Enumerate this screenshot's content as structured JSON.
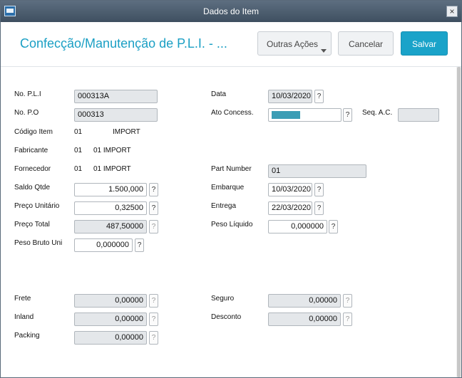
{
  "window": {
    "title": "Dados do Item",
    "close_label": "×"
  },
  "header": {
    "page_title": "Confecção/Manutenção de P.L.I. - ...",
    "more_actions_label": "Outras Ações",
    "cancel_label": "Cancelar",
    "save_label": "Salvar"
  },
  "help_label": "?",
  "form": {
    "no_pli": {
      "label": "No. P.L.I",
      "value": "000313A"
    },
    "no_po": {
      "label": "No. P.O",
      "value": "000313"
    },
    "codigo_item": {
      "label": "Código Item",
      "code": "01",
      "desc": "IMPORT"
    },
    "fabricante": {
      "label": "Fabricante",
      "code": "01",
      "desc": "01 IMPORT"
    },
    "fornecedor": {
      "label": "Fornecedor",
      "code": "01",
      "desc": "01 IMPORT"
    },
    "saldo_qtde": {
      "label": "Saldo Qtde",
      "value": "1.500,000"
    },
    "preco_unitario": {
      "label": "Preço Unitário",
      "value": "0,32500"
    },
    "preco_total": {
      "label": "Preço Total",
      "value": "487,50000"
    },
    "peso_bruto_uni": {
      "label": "Peso Bruto Uni",
      "value": "0,000000"
    },
    "data": {
      "label": "Data",
      "value": "10/03/2020"
    },
    "ato_concess": {
      "label": "Ato Concess.",
      "value": ""
    },
    "seq_ac": {
      "label": "Seq. A.C.",
      "value": ""
    },
    "part_number": {
      "label": "Part Number",
      "value": "01"
    },
    "embarque": {
      "label": "Embarque",
      "value": "10/03/2020"
    },
    "entrega": {
      "label": "Entrega",
      "value": "22/03/2020"
    },
    "peso_liquido": {
      "label": "Peso Líquido",
      "value": "0,000000"
    },
    "frete": {
      "label": "Frete",
      "value": "0,00000"
    },
    "inland": {
      "label": "Inland",
      "value": "0,00000"
    },
    "packing": {
      "label": "Packing",
      "value": "0,00000"
    },
    "seguro": {
      "label": "Seguro",
      "value": "0,00000"
    },
    "desconto": {
      "label": "Desconto",
      "value": "0,00000"
    }
  }
}
